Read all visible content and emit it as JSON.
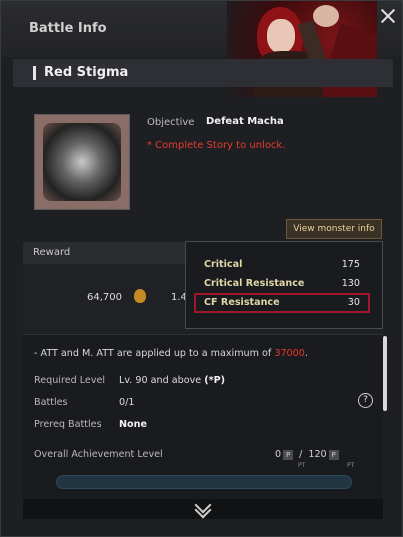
{
  "window": {
    "title": "Battle Info"
  },
  "stage": {
    "name": "Red Stigma"
  },
  "objective": {
    "label": "Objective",
    "value": "Defeat Macha",
    "unlock_text": "* Complete Story to unlock."
  },
  "buttons": {
    "view_monster_info": "View monster info"
  },
  "reward": {
    "header": "Reward",
    "gold": "64,700",
    "other": "1.4"
  },
  "tooltip": {
    "rows": [
      {
        "label": "Critical",
        "value": "175"
      },
      {
        "label": "Critical Resistance",
        "value": "130"
      },
      {
        "label": "CF Resistance",
        "value": "30"
      }
    ],
    "highlight_color": "#a0172a"
  },
  "info": {
    "note_prefix": "- ATT and M. ATT are applied up to a maximum of ",
    "note_value": "37000",
    "note_suffix": ".",
    "required_level_label": "Required Level",
    "required_level_value": "Lv. 90 and above",
    "required_level_tag": "(*P)",
    "battles_label": "Battles",
    "battles_value": "0/1",
    "prereq_label": "Prereq Battles",
    "prereq_value": "None",
    "achievement_label": "Overall Achievement Level",
    "achievement_current": "0",
    "achievement_sep": "/",
    "achievement_max": "120",
    "pt_badge": "P",
    "pt_unit": "PT"
  },
  "progress": {
    "fraction": 0.0
  },
  "icons": [
    "close-icon",
    "gold-pouch-icon",
    "help-icon",
    "scroll-down-chevron-icon"
  ],
  "colors": {
    "accent_red": "#e63b2e",
    "button_gold": "#e7d39a",
    "progress_blue": "#4c8fb0"
  }
}
